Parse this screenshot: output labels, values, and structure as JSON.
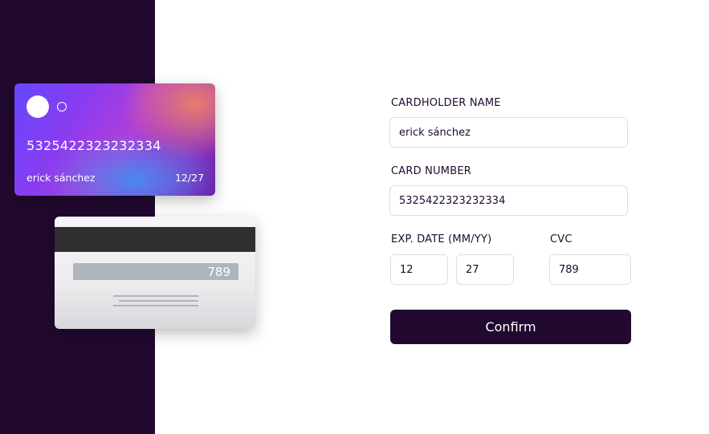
{
  "card_front": {
    "number": "5325422323232334",
    "name": "erick sánchez",
    "exp_month": "12",
    "exp_separator": "/",
    "exp_year": "27"
  },
  "card_back": {
    "cvc": "789"
  },
  "form": {
    "cardholder_label": "CARDHOLDER NAME",
    "cardholder_value": "erick sánchez",
    "card_number_label": "CARD NUMBER",
    "card_number_value": "5325422323232334",
    "exp_label": "EXP. DATE (MM/YY)",
    "exp_month_value": "12",
    "exp_year_value": "27",
    "cvc_label": "CVC",
    "cvc_value": "789",
    "confirm_label": "Confirm"
  },
  "colors": {
    "sidebar": "#21092f",
    "button": "#21092f",
    "input_border": "#dedddf"
  }
}
